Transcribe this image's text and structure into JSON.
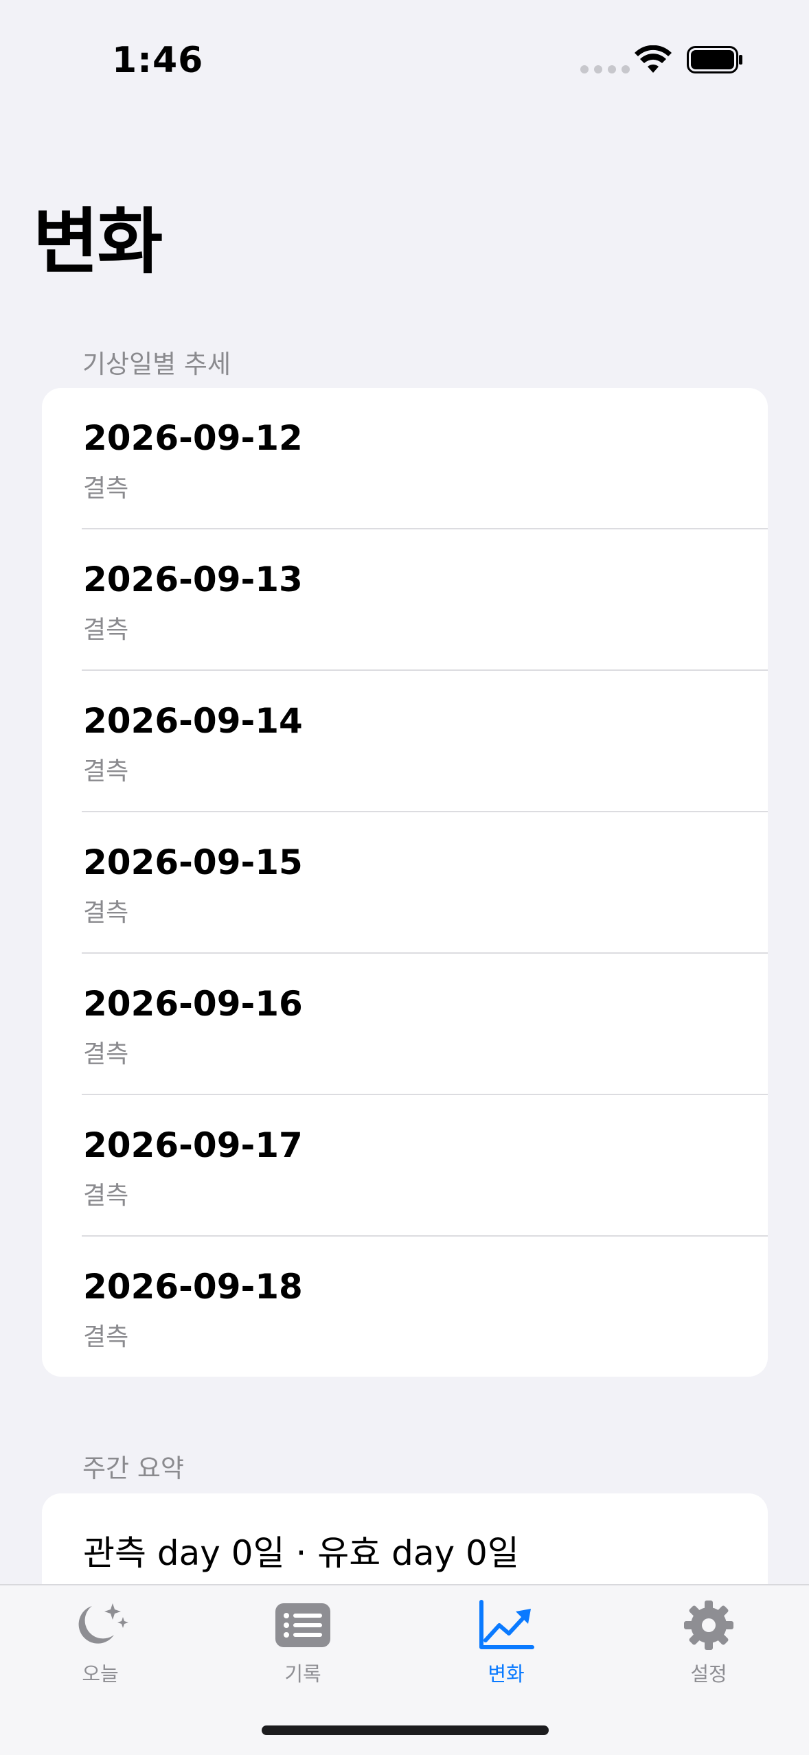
{
  "status_bar": {
    "time": "1:46"
  },
  "page": {
    "title": "변화"
  },
  "trend_section": {
    "header": "기상일별 추세",
    "rows": [
      {
        "date": "2026-09-12",
        "status": "결측"
      },
      {
        "date": "2026-09-13",
        "status": "결측"
      },
      {
        "date": "2026-09-14",
        "status": "결측"
      },
      {
        "date": "2026-09-15",
        "status": "결측"
      },
      {
        "date": "2026-09-16",
        "status": "결측"
      },
      {
        "date": "2026-09-17",
        "status": "결측"
      },
      {
        "date": "2026-09-18",
        "status": "결측"
      }
    ]
  },
  "weekly_section": {
    "header": "주간 요약",
    "summary": "관측 day 0일 · 유효 day 0일"
  },
  "tab_bar": {
    "accent_color": "#0a7aff",
    "inactive_color": "#8e8e93",
    "tabs": [
      {
        "label": "오늘",
        "icon": "moon-stars-icon",
        "active": false
      },
      {
        "label": "기록",
        "icon": "list-icon",
        "active": false
      },
      {
        "label": "변화",
        "icon": "chart-line-uptrend-icon",
        "active": true
      },
      {
        "label": "설정",
        "icon": "gear-icon",
        "active": false
      }
    ]
  }
}
